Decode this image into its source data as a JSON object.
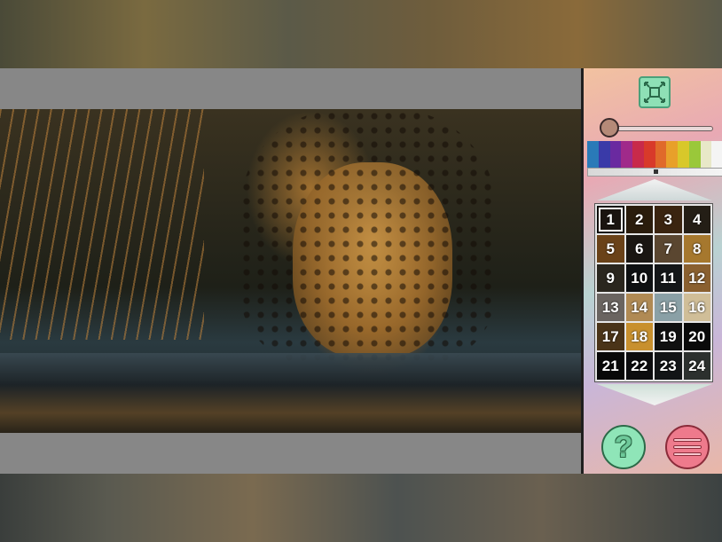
{
  "palette_bar": {
    "colors": [
      "#2a7ab8",
      "#3a3aa8",
      "#6a2aa0",
      "#a02a8a",
      "#c82a4a",
      "#d83a2a",
      "#e06a2a",
      "#e8a02a",
      "#d8c82a",
      "#9ac83a",
      "#e8e8c8",
      "#f4f4f4"
    ]
  },
  "color_grid": {
    "selected": "1",
    "cells": [
      {
        "label": "1",
        "color": "#1a1410"
      },
      {
        "label": "2",
        "color": "#2a1c0c"
      },
      {
        "label": "3",
        "color": "#3a2410"
      },
      {
        "label": "4",
        "color": "#241e16"
      },
      {
        "label": "5",
        "color": "#6a4218"
      },
      {
        "label": "6",
        "color": "#1a1612"
      },
      {
        "label": "7",
        "color": "#5a4630"
      },
      {
        "label": "8",
        "color": "#a6782e"
      },
      {
        "label": "9",
        "color": "#2a261e"
      },
      {
        "label": "10",
        "color": "#0e1012"
      },
      {
        "label": "11",
        "color": "#141618"
      },
      {
        "label": "12",
        "color": "#8a6030"
      },
      {
        "label": "13",
        "color": "#6a6460"
      },
      {
        "label": "14",
        "color": "#b08a54"
      },
      {
        "label": "15",
        "color": "#8aa0a6"
      },
      {
        "label": "16",
        "color": "#d0be98"
      },
      {
        "label": "17",
        "color": "#4a3418"
      },
      {
        "label": "18",
        "color": "#c8902e"
      },
      {
        "label": "19",
        "color": "#101010"
      },
      {
        "label": "20",
        "color": "#0a0a0a"
      },
      {
        "label": "21",
        "color": "#080808"
      },
      {
        "label": "22",
        "color": "#0c0c0e"
      },
      {
        "label": "23",
        "color": "#121416"
      },
      {
        "label": "24",
        "color": "#2c302e"
      }
    ]
  },
  "controls": {
    "zoom_level": 0.05,
    "help_label": "?"
  },
  "icons": {
    "fit": "fit-to-screen-icon",
    "menu": "hamburger-menu-icon"
  }
}
